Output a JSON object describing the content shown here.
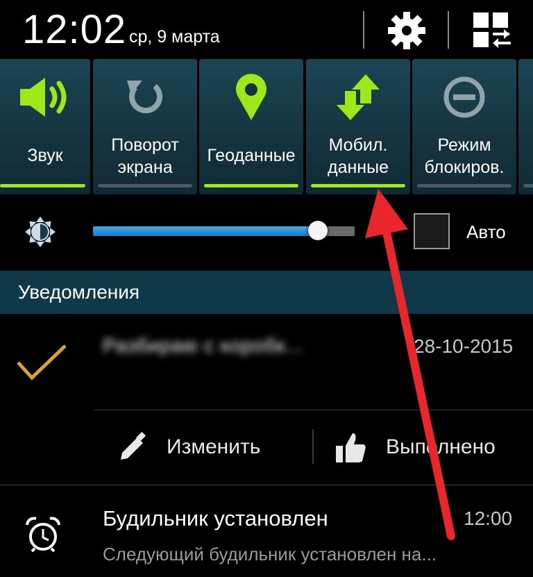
{
  "status_bar": {
    "time": "12:02",
    "date": "ср, 9 марта",
    "settings_icon": "gear-icon",
    "panel_icon": "grid-arrows-icon"
  },
  "quick_settings": [
    {
      "label": "Звук",
      "icon": "speaker-icon",
      "active": true
    },
    {
      "label": "Поворот\nэкрана",
      "icon": "rotate-icon",
      "active": false
    },
    {
      "label": "Геоданные",
      "icon": "location-pin-icon",
      "active": true
    },
    {
      "label": "Мобил.\nданные",
      "icon": "data-arrows-icon",
      "active": true
    },
    {
      "label": "Режим\nблокиров.",
      "icon": "block-mode-icon",
      "active": false
    }
  ],
  "brightness": {
    "icon": "brightness-icon",
    "level": 0.86,
    "auto_label": "Авто",
    "auto_checked": false
  },
  "notifications": {
    "header": "Уведомления",
    "task": {
      "icon": "checkmark-icon",
      "title": "Разбираю с коробк...",
      "date": "28-10-2015",
      "actions": {
        "edit_label": "Изменить",
        "done_label": "Выполнено"
      }
    },
    "alarm": {
      "icon": "alarm-clock-icon",
      "title": "Будильник установлен",
      "time": "12:00",
      "subtitle": "Следующий будильник установлен на..."
    }
  },
  "colors": {
    "active_green": "#9ee81a",
    "inactive_icon": "#8fa4ab",
    "notif_header_bg": "#0f3848",
    "arrow_red": "#e8262c",
    "checkmark_orange": "#e0a030"
  }
}
